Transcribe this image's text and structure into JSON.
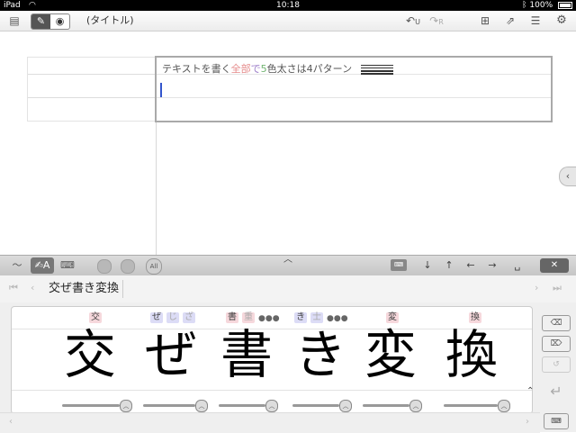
{
  "status_bar": {
    "device": "iPad",
    "time": "10:18",
    "battery": "100%"
  },
  "toolbar": {
    "title": "(タイトル)",
    "undo_label": "U",
    "redo_label": "R"
  },
  "note": {
    "line1_segments": [
      {
        "text": "テキストを書く",
        "color": "c1"
      },
      {
        "text": "全部",
        "color": "c2"
      },
      {
        "text": "で",
        "color": "c3"
      },
      {
        "text": "5",
        "color": "c4"
      },
      {
        "text": "色太さは4パターン",
        "color": "c1"
      }
    ]
  },
  "keyboard_toolbar": {
    "all_label": "All",
    "close_label": "✕"
  },
  "candidate_bar": {
    "text": "交ぜ書き変換"
  },
  "writing": {
    "characters": [
      "交",
      "ぜ",
      "書",
      "き",
      "変",
      "換"
    ],
    "candidates": [
      {
        "items": [
          "交"
        ],
        "more": false
      },
      {
        "items": [
          "ぜ",
          "じ",
          "ざ"
        ],
        "more": false
      },
      {
        "items": [
          "書",
          "重"
        ],
        "more": true
      },
      {
        "items": [
          "き",
          "士"
        ],
        "more": true
      },
      {
        "items": [
          "変"
        ],
        "more": false
      },
      {
        "items": [
          "換"
        ],
        "more": false
      }
    ]
  }
}
